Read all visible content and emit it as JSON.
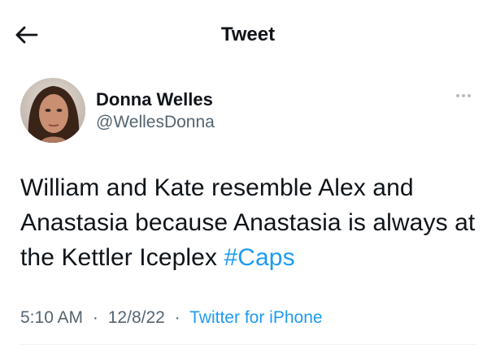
{
  "header": {
    "back_icon": "arrow-left-icon",
    "title": "Tweet"
  },
  "author": {
    "display_name": "Donna Welles",
    "handle": "@WellesDonna",
    "avatar": "profile-photo"
  },
  "more_icon": "more-horizontal-icon",
  "tweet": {
    "text_parts": [
      "William and Kate resemble Alex and Anastasia because Anastasia is always at the Kettler Iceplex "
    ],
    "hashtag": "#Caps"
  },
  "meta": {
    "time": "5:10 AM",
    "separator": "·",
    "date": "12/8/22",
    "source": "Twitter for iPhone"
  },
  "colors": {
    "text": "#0f1419",
    "secondary": "#536471",
    "link": "#1d9bf0"
  }
}
